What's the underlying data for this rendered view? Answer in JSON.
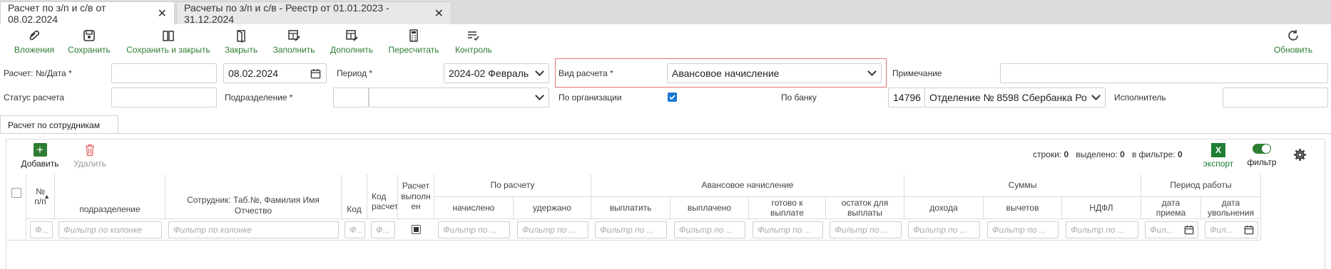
{
  "tabs": [
    {
      "label": "Расчет по з/п и с/в от 08.02.2024",
      "close": "✕"
    },
    {
      "label": "Расчеты по з/п и с/в - Реестр от 01.01.2023 - 31.12.2024",
      "close": "✕"
    }
  ],
  "toolbar": {
    "attachments": "Вложения",
    "save": "Сохранить",
    "save_close": "Сохранить и закрыть",
    "close": "Закрыть",
    "fill": "Заполнить",
    "supplement": "Дополнить",
    "recalc": "Пересчитать",
    "control": "Контроль",
    "refresh": "Обновить"
  },
  "form": {
    "number_date_label": "Расчет: №/Дата *",
    "number_value": "",
    "date_value": "08.02.2024",
    "period_label": "Период *",
    "period_value": "2024-02 Февраль",
    "calc_type_label": "Вид расчета *",
    "calc_type_value": "Авансовое начисление",
    "note_label": "Примечание",
    "note_value": "",
    "status_label": "Статус расчета",
    "status_value": "",
    "division_label": "Подразделение *",
    "by_org_label": "По организации",
    "by_org_checked": true,
    "by_bank_label": "По банку",
    "bank_code": "14796",
    "bank_name": "Отделение № 8598 Сбербанка Рос",
    "executor_label": "Исполнитель",
    "highlight_color": "#e57373"
  },
  "subtab": "Расчет по сотрудникам",
  "grid_toolbar": {
    "add": "Добавить",
    "delete": "Удалить",
    "rows_label": "строки:",
    "rows_value": "0",
    "selected_label": "выделено:",
    "selected_value": "0",
    "filter_label": "в фильтре:",
    "filter_value": "0",
    "export": "экспорт",
    "filter": "фильтр",
    "accent": "#2e7d32"
  },
  "columns": {
    "num": "№ п/п",
    "division": "подразделение",
    "employee": "Сотрудник: Таб.№, Фамилия Имя Отчество",
    "code": "Код",
    "code_calc": "Код расчета",
    "calc_done": "Расчет выполнен",
    "group_calc": "По расчету",
    "accrued": "начислено",
    "withheld": "удержано",
    "group_advance": "Авансовое начисление",
    "pay": "выплатить",
    "paid": "выплачено",
    "ready": "готово к выплате",
    "rest": "остаток для выплаты",
    "group_sums": "Суммы",
    "income": "дохода",
    "deductions": "вычетов",
    "ndfl": "НДФЛ",
    "group_period": "Период работы",
    "hire": "дата приема",
    "fire": "дата увольнения"
  },
  "filters": {
    "short": "Ф...",
    "column": "Фильтр по колонке",
    "mid": "Фильтр по ...",
    "date": "Фил..."
  }
}
